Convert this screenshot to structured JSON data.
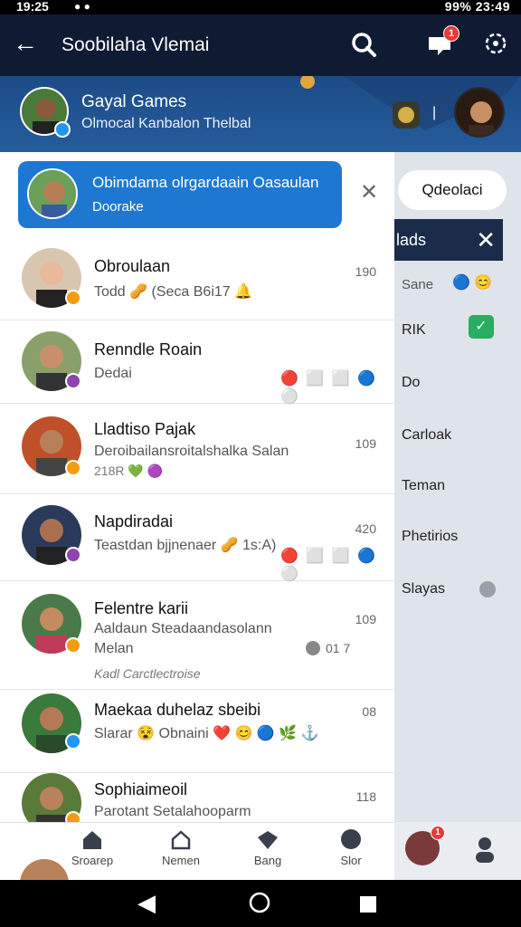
{
  "status_bar": {
    "time": "19:25",
    "right": "99% 23:49"
  },
  "app_bar": {
    "title": "Soobilaha Vlemai",
    "back_icon": "arrow-left-icon",
    "notification_count": "1"
  },
  "profile": {
    "name": "Gayal Games",
    "subtitle": "Olmocal Kanbalon Thelbal"
  },
  "banner": {
    "line1": "Obimdama olrgardaain Oasaulan",
    "line2": "Doorake"
  },
  "conversations": [
    {
      "name": "Obroulaan",
      "sub": "Todd  🥜 (Seca B6i17  🔔",
      "count": "190",
      "badge_color": "#f39c12"
    },
    {
      "name": "Renndle Roain",
      "sub": "Dedai",
      "count": "",
      "badge_color": "#8e44ad"
    },
    {
      "name": "Lladtiso Pajak",
      "sub": "Deroibailansroitalshalka Salan",
      "sub2": "218R  💚  🟣",
      "count": "109",
      "badge_color": "#f39c12"
    },
    {
      "name": "Napdiradai",
      "sub": "Teastdan bjjnenaer  🥜  1s:A)",
      "count": "420",
      "badge_color": "#8e44ad"
    },
    {
      "name": "Felentre karii",
      "sub": "Aaldaun Steadaandasolann",
      "sub2": "Melan",
      "sub3": "Kadl Carctlectroise",
      "count": "109",
      "extra": "01 7",
      "badge_color": "#f39c12"
    },
    {
      "name": "Maekaa duhelaz sbeibi",
      "sub": "Slarar  😵  Obnaini  ❤️  😊  🔵  🌿  ⚓",
      "count": "08",
      "badge_color": "#2196f3"
    },
    {
      "name": "Sophiaimeoil",
      "sub": "Parotant Setalahooparm",
      "count": "118",
      "badge_color": "#f39c12"
    }
  ],
  "right_panel": {
    "button": "Qdeolaci",
    "header": "lads",
    "items": [
      "Sane",
      "RIK",
      "Do",
      "Carloak",
      "Teman",
      "Phetirios",
      "Slayas"
    ]
  },
  "bottom_nav": [
    {
      "label": "Sroarep",
      "icon": "home-icon"
    },
    {
      "label": "Nemen",
      "icon": "users-icon"
    },
    {
      "label": "Bang",
      "icon": "tag-icon"
    },
    {
      "label": "Slor",
      "icon": "chat-icon"
    }
  ],
  "right_nav_badge": "1"
}
